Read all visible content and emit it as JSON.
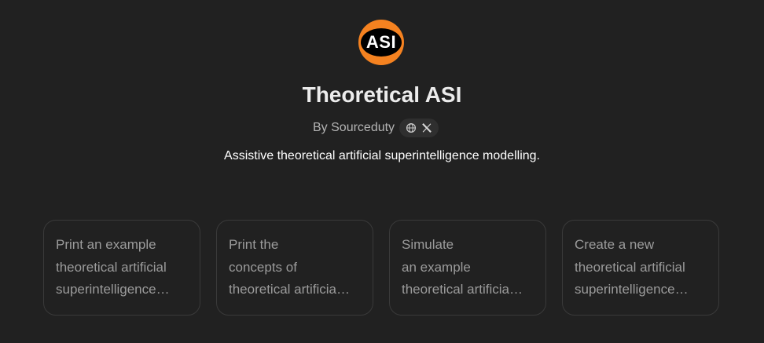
{
  "logo": {
    "text": "ASI"
  },
  "title": "Theoretical ASI",
  "author": {
    "by_text": "By Sourceduty",
    "links": [
      "globe-icon",
      "x-logo-icon"
    ]
  },
  "description": "Assistive theoretical artificial superintelligence modelling.",
  "colors": {
    "background": "#212121",
    "logo_orange": "#f58220",
    "card_border": "#3a3a3a"
  },
  "starters": [
    {
      "lines": [
        "Print an example",
        "theoretical artificial",
        "superintelligence…"
      ]
    },
    {
      "lines": [
        "Print the",
        "concepts of",
        "theoretical artificia…"
      ]
    },
    {
      "lines": [
        "Simulate",
        "an example",
        "theoretical artificia…"
      ]
    },
    {
      "lines": [
        "Create a new",
        "theoretical artificial",
        "superintelligence…"
      ]
    }
  ]
}
